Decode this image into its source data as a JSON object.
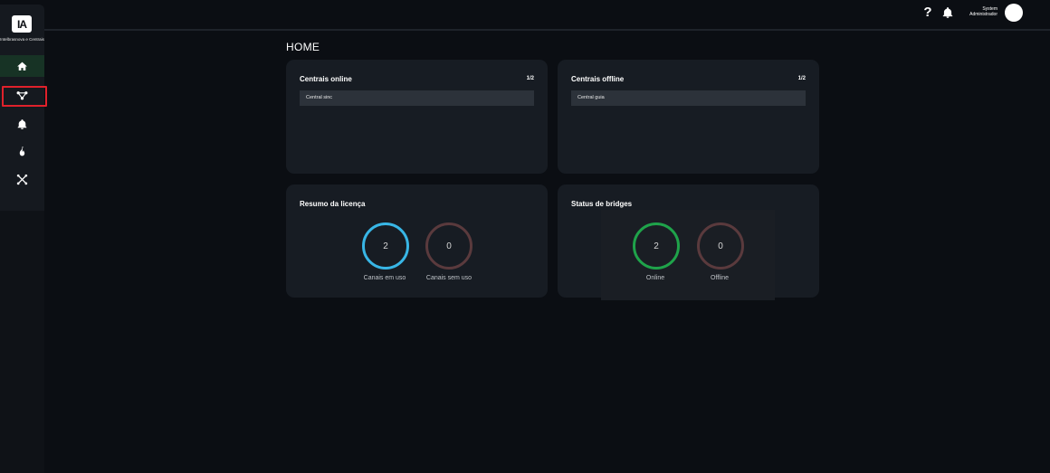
{
  "app": {
    "logo_mark": "IA",
    "logo_text": "Intelbrasnova e Centrais"
  },
  "sidebar": {
    "items": [
      {
        "name": "home",
        "icon": "home-icon",
        "active": true
      },
      {
        "name": "network",
        "icon": "network-icon",
        "active": false,
        "highlighted": true
      },
      {
        "name": "alarms",
        "icon": "bell-icon",
        "active": false
      },
      {
        "name": "fire",
        "icon": "fire-icon",
        "active": false
      },
      {
        "name": "tools",
        "icon": "tools-icon",
        "active": false
      }
    ]
  },
  "topbar": {
    "help_label": "?",
    "user_first": "System",
    "user_role": "Administrador"
  },
  "page": {
    "title": "HOME"
  },
  "cards": {
    "online": {
      "title": "Centrais online",
      "count": "1/2",
      "rows": [
        "Central sinc"
      ]
    },
    "offline": {
      "title": "Centrais offline",
      "count": "1/2",
      "rows": [
        "Central guia"
      ]
    },
    "license": {
      "title": "Resumo da licença",
      "rings": [
        {
          "value": "2",
          "label": "Canais em uso",
          "color": "#38b6e6"
        },
        {
          "value": "0",
          "label": "Canais sem uso",
          "color": "#5a3a3d"
        }
      ]
    },
    "bridges": {
      "title": "Status de bridges",
      "rings": [
        {
          "value": "2",
          "label": "Online",
          "color": "#1fa34a"
        },
        {
          "value": "0",
          "label": "Offline",
          "color": "#5a3a3d"
        }
      ]
    }
  },
  "colors": {
    "background": "#0b0e13",
    "card": "#171c23",
    "active_nav": "#173325",
    "highlight": "#e0212b"
  }
}
